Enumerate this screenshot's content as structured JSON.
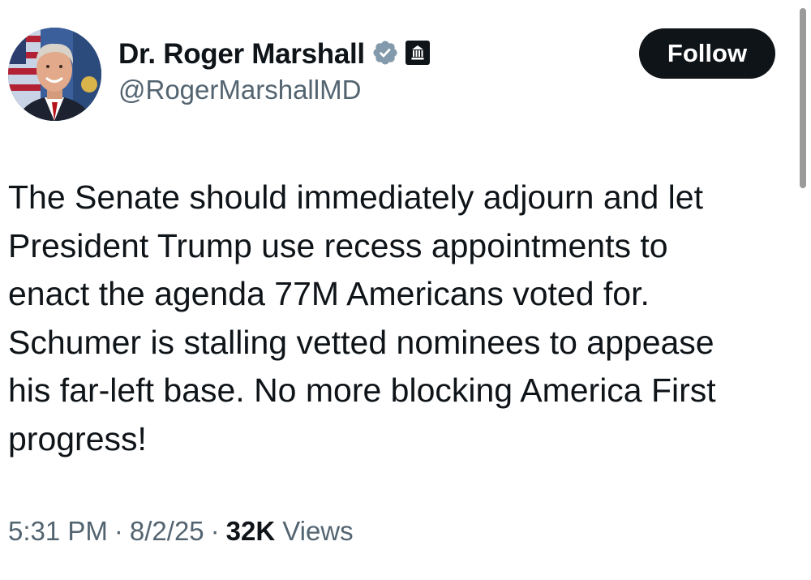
{
  "author": {
    "display_name": "Dr. Roger Marshall",
    "handle": "@RogerMarshallMD",
    "verified": true,
    "verified_color": "#829aab",
    "government_badge": true,
    "avatar_icon": "profile-photo"
  },
  "follow_label": "Follow",
  "tweet": {
    "text": "The Senate should immediately adjourn and let\nPresident Trump use recess appointments to\nenact the agenda 77M Americans voted for.\nSchumer is stalling vetted nominees to appease\nhis far-left base. No more blocking America First\nprogress!"
  },
  "meta": {
    "time": "5:31 PM",
    "separator": "·",
    "date": "8/2/25",
    "views_count": "32K",
    "views_label": "Views"
  },
  "colors": {
    "text_primary": "#0f1419",
    "text_secondary": "#536471",
    "button_bg": "#0f1419",
    "button_text": "#ffffff"
  }
}
